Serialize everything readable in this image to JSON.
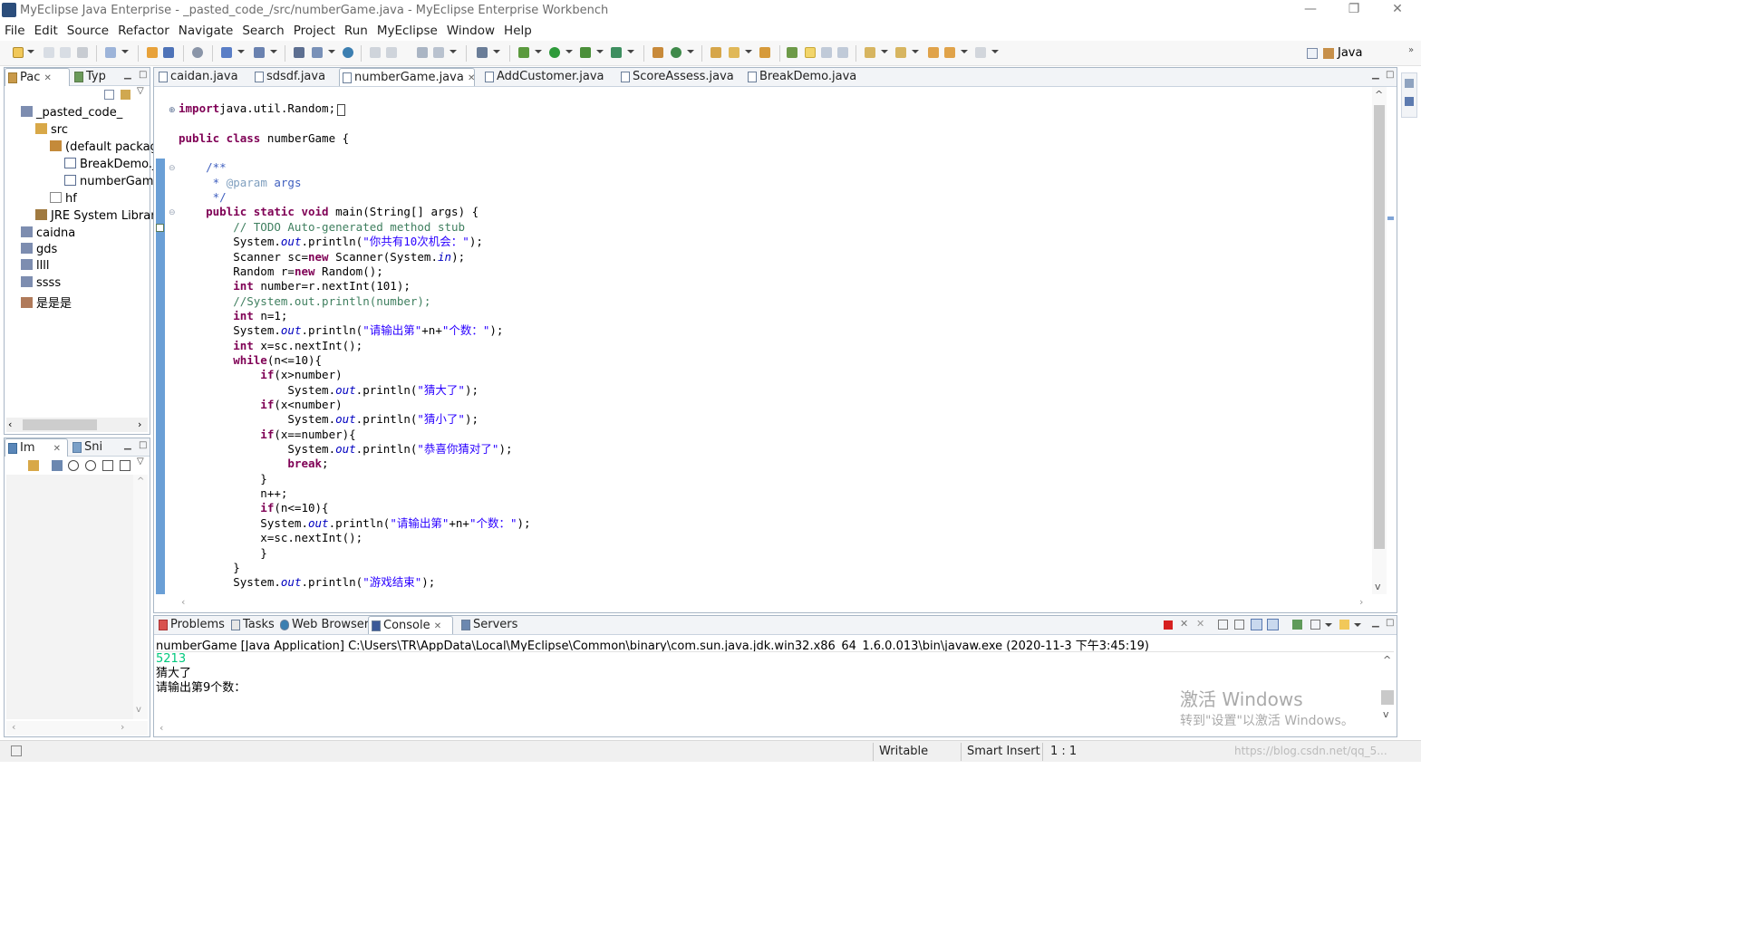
{
  "window": {
    "title": "MyEclipse Java Enterprise - _pasted_code_/src/numberGame.java - MyEclipse Enterprise Workbench",
    "minimize": "—",
    "restore": "❐",
    "close": "✕"
  },
  "menu": [
    "File",
    "Edit",
    "Source",
    "Refactor",
    "Navigate",
    "Search",
    "Project",
    "Run",
    "MyEclipse",
    "Window",
    "Help"
  ],
  "perspective": {
    "label": "Java"
  },
  "package_explorer": {
    "tabs": [
      "Pac",
      "Typ"
    ],
    "items": [
      {
        "label": "_pasted_code_",
        "icon": "project-icon"
      },
      {
        "label": "src",
        "icon": "source-folder-icon"
      },
      {
        "label": "(default packag",
        "icon": "package-icon"
      },
      {
        "label": "BreakDemo.j",
        "icon": "java-file-icon"
      },
      {
        "label": "numberGam",
        "icon": "java-file-icon"
      },
      {
        "label": "hf",
        "icon": "package-icon"
      },
      {
        "label": "JRE System Library",
        "icon": "library-icon"
      },
      {
        "label": "caidna",
        "icon": "project-icon"
      },
      {
        "label": "gds",
        "icon": "project-icon"
      },
      {
        "label": "llll",
        "icon": "project-icon"
      },
      {
        "label": "ssss",
        "icon": "project-icon"
      },
      {
        "label": "是是是",
        "icon": "project-icon"
      }
    ]
  },
  "image_view": {
    "tabs": [
      "Im",
      "Sni"
    ]
  },
  "editor": {
    "tabs": [
      "caidan.java",
      "sdsdf.java",
      "numberGame.java",
      "AddCustomer.java",
      "ScoreAssess.java",
      "BreakDemo.java"
    ],
    "active_tab": "numberGame.java",
    "lines": [
      {
        "t": [
          [
            "kw",
            "import"
          ],
          [
            "",
            "java.util.Random;"
          ]
        ]
      },
      {
        "t": []
      },
      {
        "t": [
          [
            "kw",
            "public class"
          ],
          [
            "",
            " numberGame {"
          ]
        ]
      },
      {
        "t": []
      },
      {
        "t": [
          [
            "jd",
            "    /**"
          ]
        ]
      },
      {
        "t": [
          [
            "jd",
            "     * "
          ],
          [
            "jt",
            "@param"
          ],
          [
            "jd",
            " args"
          ]
        ]
      },
      {
        "t": [
          [
            "jd",
            "     */"
          ]
        ]
      },
      {
        "t": [
          [
            "kw",
            "    public static void"
          ],
          [
            "",
            " main(String[] args) {"
          ]
        ]
      },
      {
        "t": [
          [
            "cm",
            "        // TODO Auto-generated method stub"
          ]
        ]
      },
      {
        "t": [
          [
            "",
            "        System."
          ],
          [
            "fi",
            "out"
          ],
          [
            "",
            ".println("
          ],
          [
            "st",
            "\"你共有10次机会：\""
          ],
          [
            "",
            ");"
          ]
        ]
      },
      {
        "t": [
          [
            "",
            "        Scanner sc="
          ],
          [
            "kw",
            "new"
          ],
          [
            "",
            " Scanner(System."
          ],
          [
            "fi",
            "in"
          ],
          [
            "",
            ");"
          ]
        ]
      },
      {
        "t": [
          [
            "",
            "        Random r="
          ],
          [
            "kw",
            "new"
          ],
          [
            "",
            " Random();"
          ]
        ]
      },
      {
        "t": [
          [
            "kw",
            "        int"
          ],
          [
            "",
            " number=r.nextInt(101);"
          ]
        ]
      },
      {
        "t": [
          [
            "cm",
            "        //System.out.println(number);"
          ]
        ]
      },
      {
        "t": [
          [
            "kw",
            "        int"
          ],
          [
            "",
            " n=1;"
          ]
        ]
      },
      {
        "t": [
          [
            "",
            "        System."
          ],
          [
            "fi",
            "out"
          ],
          [
            "",
            ".println("
          ],
          [
            "st",
            "\"请输出第\""
          ],
          [
            "",
            "+n+"
          ],
          [
            "st",
            "\"个数：\""
          ],
          [
            "",
            ");"
          ]
        ]
      },
      {
        "t": [
          [
            "kw",
            "        int"
          ],
          [
            "",
            " x=sc.nextInt();"
          ]
        ]
      },
      {
        "t": [
          [
            "kw",
            "        while"
          ],
          [
            "",
            "(n<=10){"
          ]
        ]
      },
      {
        "t": [
          [
            "kw",
            "            if"
          ],
          [
            "",
            "(x>number)"
          ]
        ]
      },
      {
        "t": [
          [
            "",
            "                System."
          ],
          [
            "fi",
            "out"
          ],
          [
            "",
            ".println("
          ],
          [
            "st",
            "\"猜大了\""
          ],
          [
            "",
            ");"
          ]
        ]
      },
      {
        "t": [
          [
            "kw",
            "            if"
          ],
          [
            "",
            "(x<number)"
          ]
        ]
      },
      {
        "t": [
          [
            "",
            "                System."
          ],
          [
            "fi",
            "out"
          ],
          [
            "",
            ".println("
          ],
          [
            "st",
            "\"猜小了\""
          ],
          [
            "",
            ");"
          ]
        ]
      },
      {
        "t": [
          [
            "kw",
            "            if"
          ],
          [
            "",
            "(x==number){"
          ]
        ]
      },
      {
        "t": [
          [
            "",
            "                System."
          ],
          [
            "fi",
            "out"
          ],
          [
            "",
            ".println("
          ],
          [
            "st",
            "\"恭喜你猜对了\""
          ],
          [
            "",
            ");"
          ]
        ]
      },
      {
        "t": [
          [
            "kw",
            "                break"
          ],
          [
            "",
            ";"
          ]
        ]
      },
      {
        "t": [
          [
            "",
            "            }"
          ]
        ]
      },
      {
        "t": [
          [
            "",
            "            n++;"
          ]
        ]
      },
      {
        "t": [
          [
            "kw",
            "            if"
          ],
          [
            "",
            "(n<=10){"
          ]
        ]
      },
      {
        "t": [
          [
            "",
            "            System."
          ],
          [
            "fi",
            "out"
          ],
          [
            "",
            ".println("
          ],
          [
            "st",
            "\"请输出第\""
          ],
          [
            "",
            "+n+"
          ],
          [
            "st",
            "\"个数：\""
          ],
          [
            "",
            ");"
          ]
        ]
      },
      {
        "t": [
          [
            "",
            "            x=sc.nextInt();"
          ]
        ]
      },
      {
        "t": [
          [
            "",
            "            }"
          ]
        ]
      },
      {
        "t": [
          [
            "",
            "        }"
          ]
        ]
      },
      {
        "t": [
          [
            "",
            "        System."
          ],
          [
            "fi",
            "out"
          ],
          [
            "",
            ".println("
          ],
          [
            "st",
            "\"游戏结束\""
          ],
          [
            "",
            ");"
          ]
        ]
      }
    ]
  },
  "console_view": {
    "tabs": [
      "Problems",
      "Tasks",
      "Web Browser",
      "Console",
      "Servers"
    ],
    "active_tab": "Console",
    "header": "numberGame [Java Application] C:\\Users\\TR\\AppData\\Local\\MyEclipse\\Common\\binary\\com.sun.java.jdk.win32.x86_64_1.6.0.013\\bin\\javaw.exe (2020-11-3 下午3:45:19)",
    "output": [
      {
        "text": "5213",
        "color": "#00c87d"
      },
      {
        "text": "猜大了",
        "color": "#000000"
      },
      {
        "text": "请输出第9个数：",
        "color": "#000000"
      }
    ]
  },
  "watermark": {
    "line1": "激活 Windows",
    "line2": "转到\"设置\"以激活 Windows。"
  },
  "statusbar": {
    "writable": "Writable",
    "insert_mode": "Smart Insert",
    "position": "1 : 1",
    "url": "https://blog.csdn.net/qq_5..."
  }
}
